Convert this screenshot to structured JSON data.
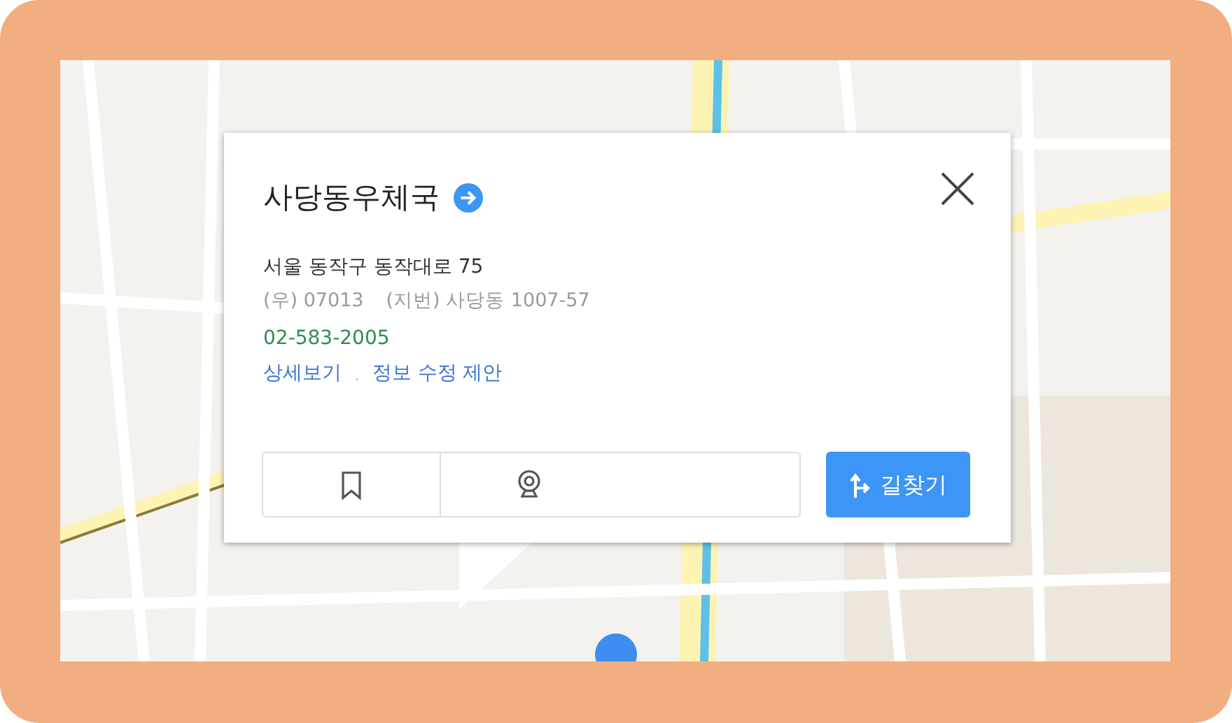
{
  "place": {
    "title": "사당동우체국",
    "address": "서울 동작구 동작대로 75",
    "postal_code": "(우) 07013",
    "lot_address": "(지번) 사당동 1007-57",
    "phone": "02-583-2005",
    "links": [
      "상세보기",
      "정보 수정 제안"
    ],
    "link_separator": "."
  },
  "actions": [
    {
      "kind": "bookmark"
    },
    {
      "kind": "roadview"
    }
  ],
  "directions_button": {
    "label": "길찾기"
  }
}
